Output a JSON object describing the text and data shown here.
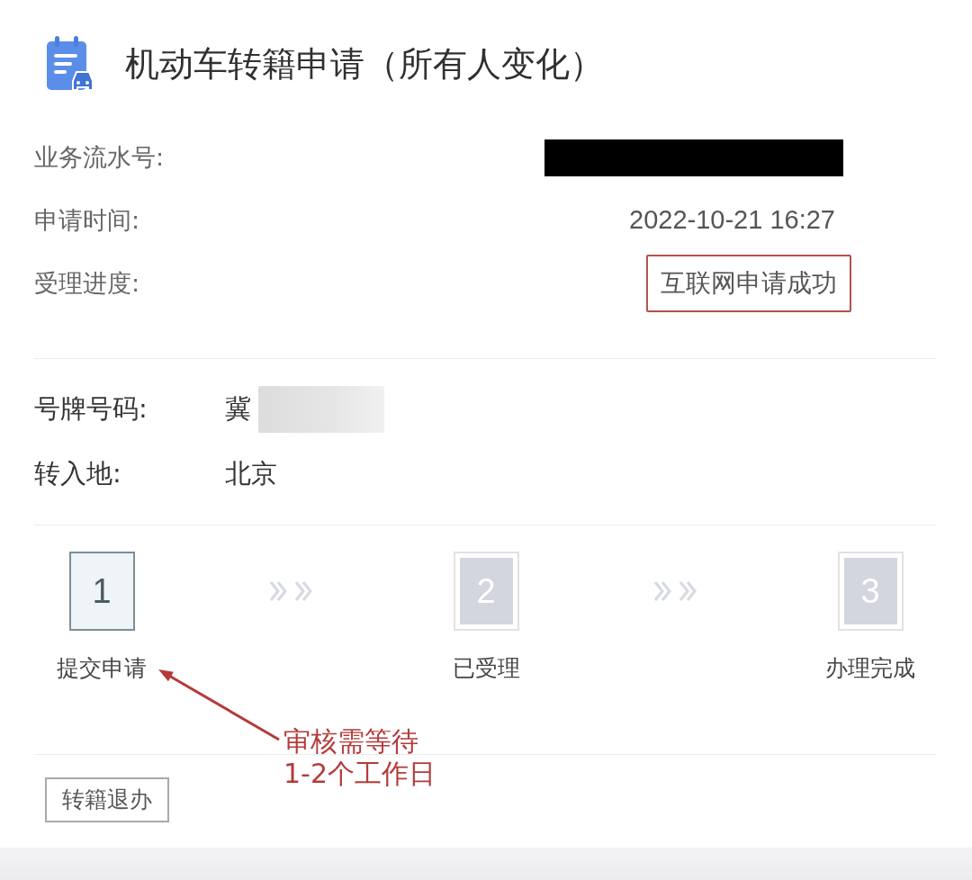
{
  "header": {
    "title": "机动车转籍申请（所有人变化）"
  },
  "details": [
    {
      "label": "业务流水号:",
      "kind": "redacted"
    },
    {
      "label": "申请时间:",
      "kind": "text",
      "value": "2022-10-21 16:27"
    },
    {
      "label": "受理进度:",
      "kind": "status",
      "value": "互联网申请成功"
    }
  ],
  "vehicle": [
    {
      "label": "号牌号码:",
      "kind": "blurred",
      "value": "冀"
    },
    {
      "label": "转入地:",
      "kind": "text",
      "value": "北京"
    }
  ],
  "steps": [
    {
      "number": "1",
      "label": "提交申请",
      "active": true
    },
    {
      "number": "2",
      "label": "已受理",
      "active": false
    },
    {
      "number": "3",
      "label": "办理完成",
      "active": false
    }
  ],
  "annotation": {
    "text": "审核需等待\n1-2个工作日"
  },
  "actions": [
    {
      "label": "转籍退办"
    }
  ]
}
